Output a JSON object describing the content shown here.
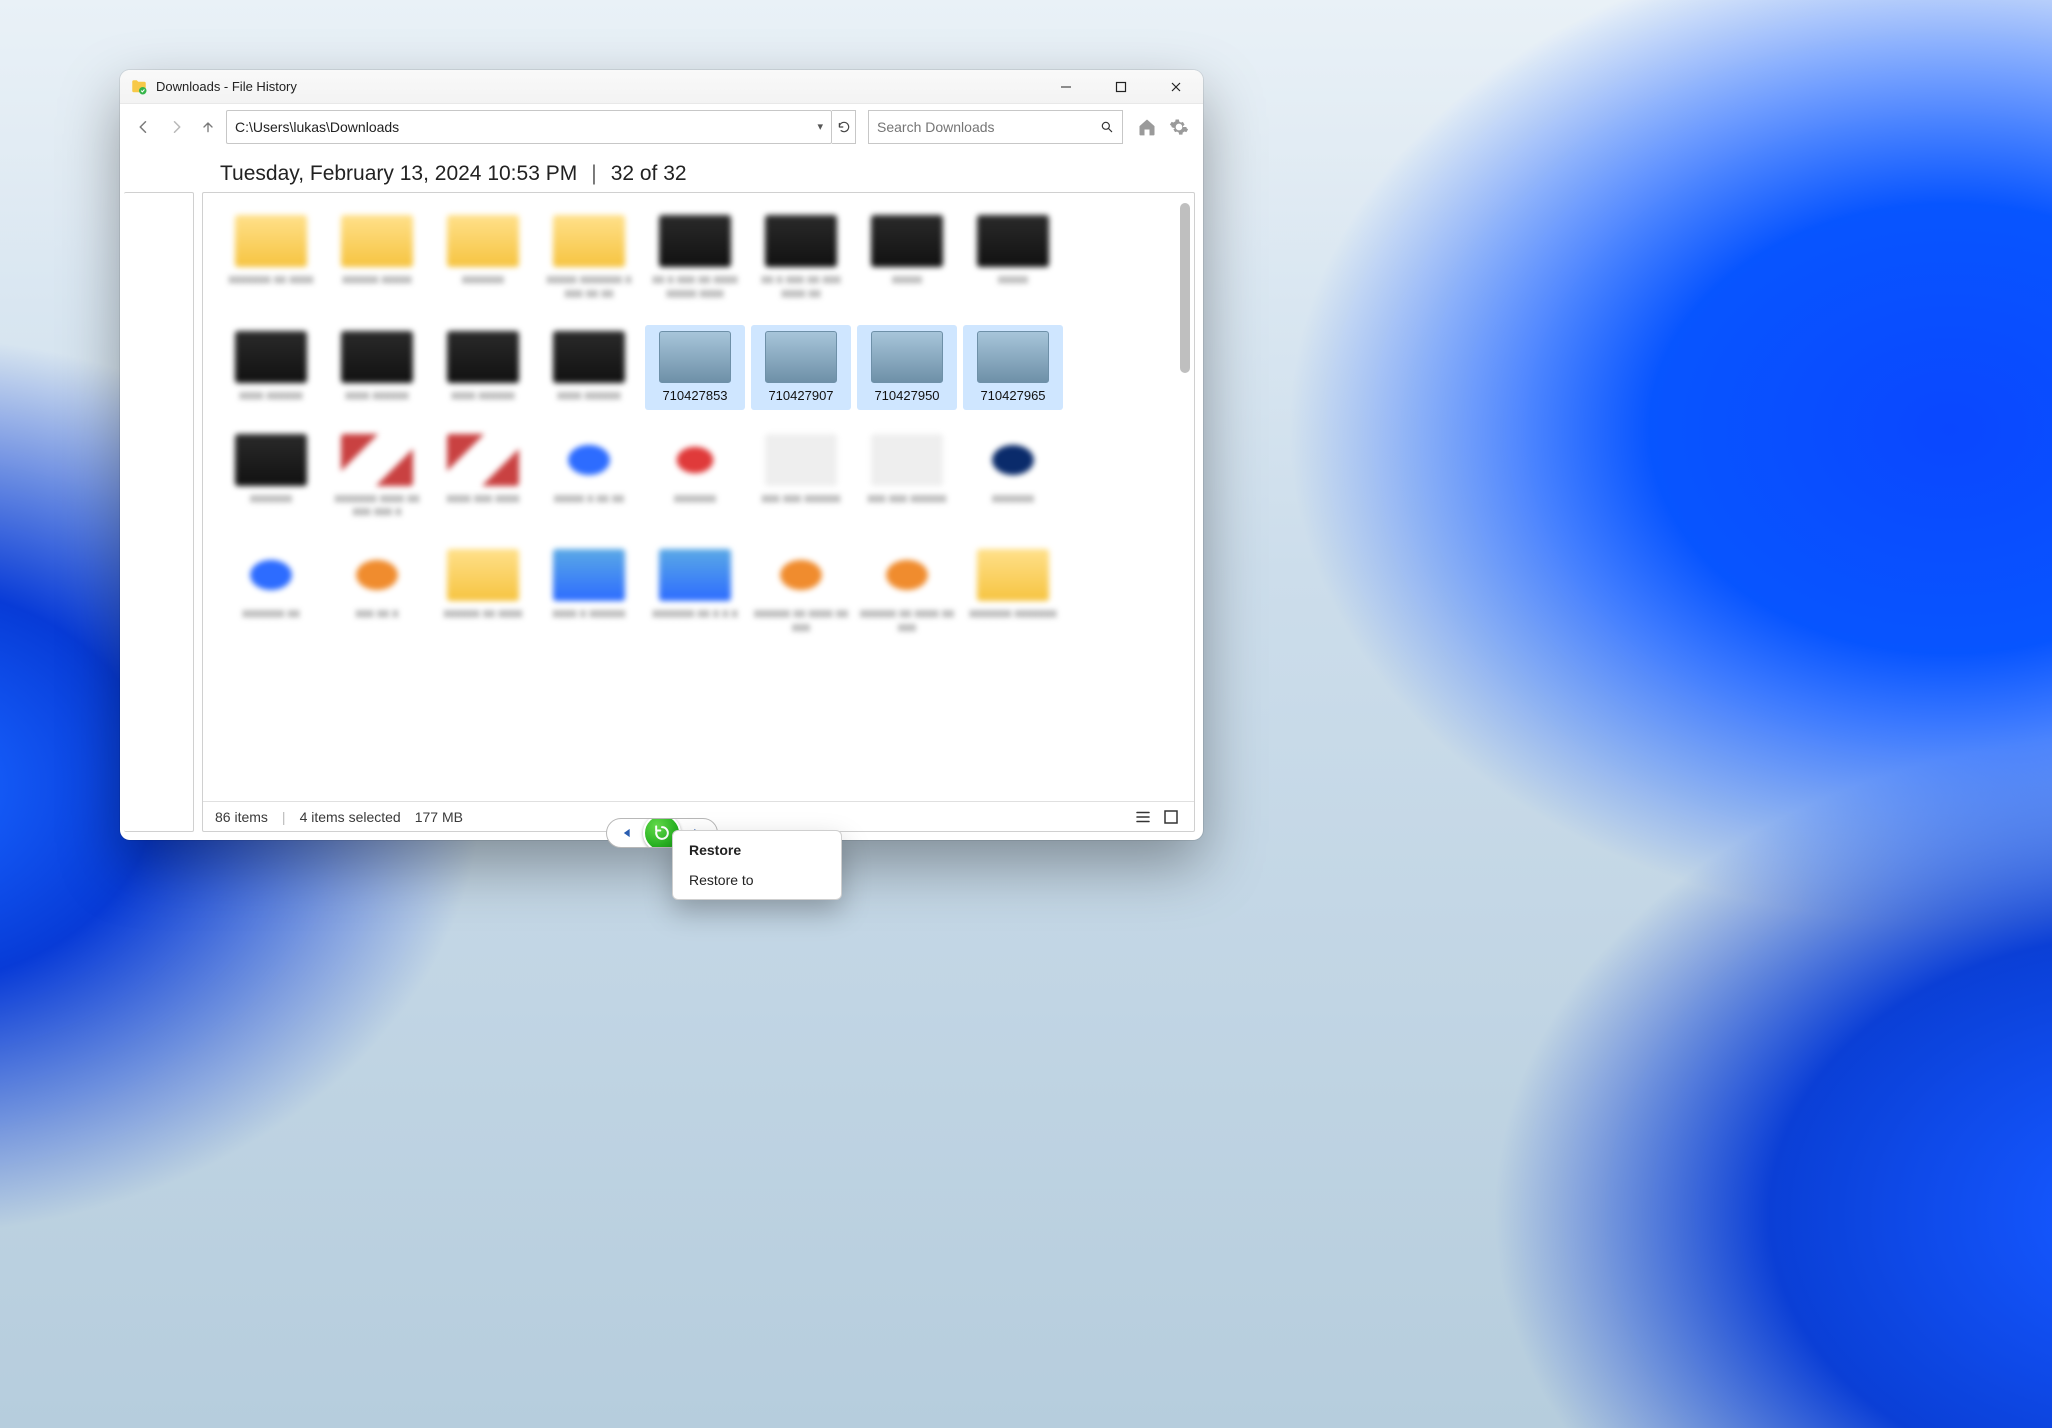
{
  "window": {
    "title": "Downloads - File History"
  },
  "toolbar": {
    "path": "C:\\Users\\lukas\\Downloads",
    "search_placeholder": "Search Downloads"
  },
  "info": {
    "timestamp": "Tuesday, February 13, 2024 10:53 PM",
    "sep": "|",
    "page_index": "32 of 32"
  },
  "selected": [
    {
      "name": "710427853"
    },
    {
      "name": "710427907"
    },
    {
      "name": "710427950"
    },
    {
      "name": "710427965"
    }
  ],
  "status": {
    "items": "86 items",
    "selection": "4 items selected",
    "size": "177 MB"
  },
  "context_menu": {
    "restore": "Restore",
    "restore_to": "Restore to"
  }
}
